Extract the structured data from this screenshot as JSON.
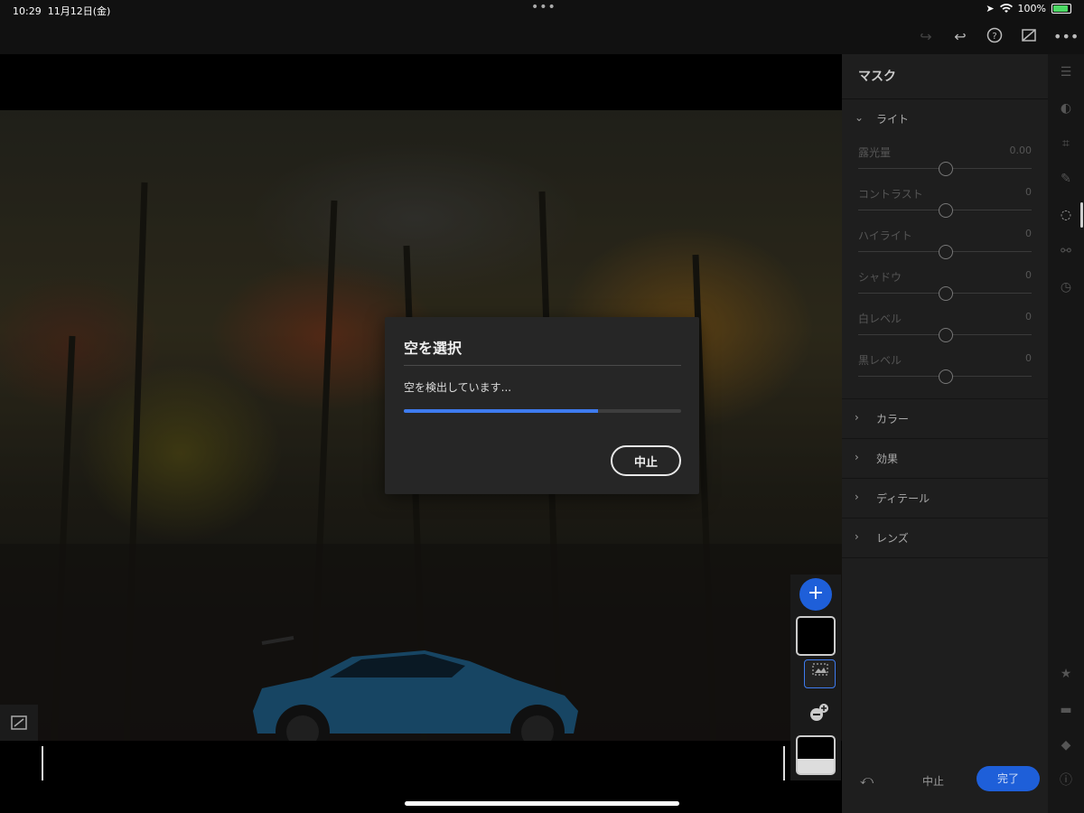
{
  "status_bar": {
    "time": "10:29",
    "date": "11月12日(金)",
    "dots": "•••",
    "battery_percent": "100%"
  },
  "toolbar": {
    "icons": [
      "redo-icon",
      "undo-icon",
      "help-icon",
      "compare-icon",
      "more-icon"
    ]
  },
  "dialog": {
    "title": "空を選択",
    "message": "空を検出しています...",
    "progress": 0.7,
    "cancel_label": "中止"
  },
  "panel": {
    "title": "マスク",
    "light_section": {
      "label": "ライト",
      "sliders": [
        {
          "label": "露光量",
          "value": "0.00"
        },
        {
          "label": "コントラスト",
          "value": "0"
        },
        {
          "label": "ハイライト",
          "value": "0"
        },
        {
          "label": "シャドウ",
          "value": "0"
        },
        {
          "label": "白レベル",
          "value": "0"
        },
        {
          "label": "黒レベル",
          "value": "0"
        }
      ]
    },
    "sections": [
      {
        "label": "カラー"
      },
      {
        "label": "効果"
      },
      {
        "label": "ディテール"
      },
      {
        "label": "レンズ"
      }
    ],
    "footer": {
      "cancel_label": "中止",
      "done_label": "完了"
    }
  },
  "mask_column": {
    "add_label": "+"
  },
  "colors": {
    "accent": "#3e7bef",
    "button_blue": "#1e5fd9",
    "panel_bg": "#1e1e1e"
  }
}
